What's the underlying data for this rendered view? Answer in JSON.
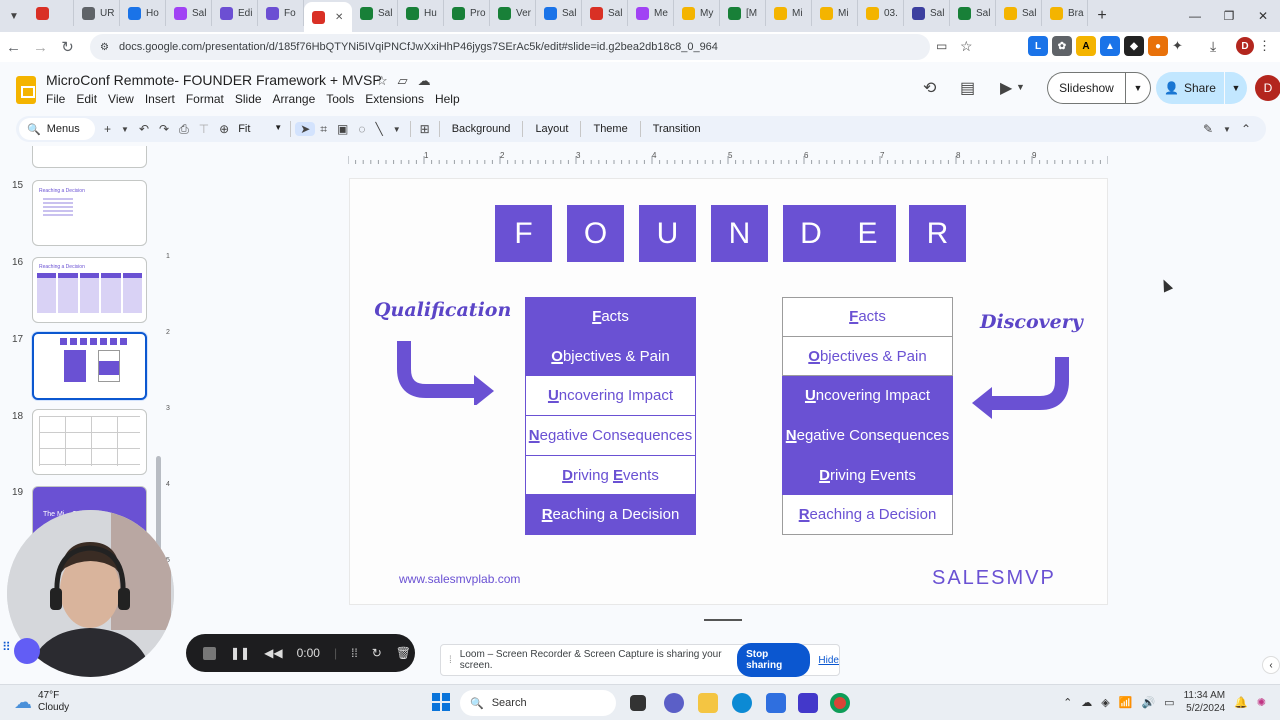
{
  "browser": {
    "tabs": [
      {
        "label": "",
        "color": "#d93025"
      },
      {
        "label": "UR",
        "color": "#5f6368"
      },
      {
        "label": "Ho",
        "color": "#1a73e8"
      },
      {
        "label": "Sal",
        "color": "#a142f4"
      },
      {
        "label": "Edi",
        "color": "#6c4fd3"
      },
      {
        "label": "Fo",
        "color": "#6c4fd3"
      },
      {
        "label": "",
        "color": "#d93025"
      },
      {
        "label": "Sal",
        "color": "#188038"
      },
      {
        "label": "Hu",
        "color": "#188038"
      },
      {
        "label": "Pro",
        "color": "#188038"
      },
      {
        "label": "Ver",
        "color": "#188038"
      },
      {
        "label": "Sal",
        "color": "#1a73e8"
      },
      {
        "label": "Sal",
        "color": "#d93025"
      },
      {
        "label": "Me",
        "color": "#a142f4"
      },
      {
        "label": "My",
        "color": "#f4b400"
      },
      {
        "label": "[M",
        "color": "#188038"
      },
      {
        "label": "Mi",
        "color": "#f4b400"
      },
      {
        "label": "Mi",
        "color": "#f4b400"
      },
      {
        "label": "03.",
        "color": "#f4b400"
      },
      {
        "label": "Sal",
        "color": "#3c3f9f"
      },
      {
        "label": "Sal",
        "color": "#188038"
      },
      {
        "label": "Sal",
        "color": "#f4b400"
      },
      {
        "label": "Bra",
        "color": "#f4b400"
      }
    ],
    "url": "docs.google.com/presentation/d/185f76HbQTYNi5IVqiPNCfJwXxiHhP46jygs7SErAc5k/edit#slide=id.g2bea2db18c8_0_964"
  },
  "app": {
    "title": "MicroConf Remmote- FOUNDER Framework + MVSP",
    "menu": [
      "File",
      "Edit",
      "View",
      "Insert",
      "Format",
      "Slide",
      "Arrange",
      "Tools",
      "Extensions",
      "Help"
    ],
    "slideshow_label": "Slideshow",
    "share_label": "Share",
    "user_initial": "D"
  },
  "toolbar": {
    "search_label": "Menus",
    "zoom": "Fit",
    "background_label": "Background",
    "layout_label": "Layout",
    "theme_label": "Theme",
    "transition_label": "Transition"
  },
  "filmstrip": {
    "slides": [
      {
        "number": "15",
        "title": "Reaching a Decision"
      },
      {
        "number": "16",
        "title": "Reaching a Decision"
      },
      {
        "number": "17",
        "title": "",
        "selected": true
      },
      {
        "number": "18",
        "title": ""
      },
      {
        "number": "19",
        "title": "The Mi... Sales"
      }
    ]
  },
  "ruler": {
    "inches": [
      "1",
      "2",
      "3",
      "4",
      "5",
      "6",
      "7",
      "8",
      "9"
    ],
    "vertical": [
      "1",
      "2",
      "3",
      "4",
      "5"
    ]
  },
  "slide": {
    "letters": [
      "F",
      "O",
      "U",
      "N",
      "D",
      "E",
      "R"
    ],
    "left_label": "Qualification",
    "right_label": "Discovery",
    "left_column": [
      {
        "initial": "F",
        "rest": "acts",
        "style": "filled"
      },
      {
        "initial": "O",
        "rest": "bjectives & Pain",
        "style": "filled"
      },
      {
        "initial": "U",
        "rest": "ncovering Impact",
        "style": "outline"
      },
      {
        "initial": "N",
        "rest": "egative Consequences",
        "style": "outline"
      },
      {
        "initial": "D",
        "rest": "riving ",
        "initial2": "E",
        "rest2": "vents",
        "style": "outline"
      },
      {
        "initial": "R",
        "rest": "eaching a Decision",
        "style": "filled"
      }
    ],
    "right_column": [
      {
        "initial": "F",
        "rest": "acts",
        "style": "outline"
      },
      {
        "initial": "O",
        "rest": "bjectives & Pain",
        "style": "outline"
      },
      {
        "initial": "U",
        "rest": "ncovering Impact",
        "style": "filled"
      },
      {
        "initial": "N",
        "rest": "egative Consequences",
        "style": "filled"
      },
      {
        "initial": "D",
        "rest": "riving Events",
        "style": "filled"
      },
      {
        "initial": "R",
        "rest": "eaching a Decision",
        "style": "outline"
      }
    ],
    "website": "www.salesmvplab.com",
    "brand": "SALESMVP",
    "accent_color": "#6a51d3"
  },
  "loom": {
    "timer": "0:00",
    "notice": "Loom – Screen Recorder & Screen Capture is sharing your screen.",
    "stop_label": "Stop sharing",
    "hide_label": "Hide"
  },
  "taskbar": {
    "temperature": "47°F",
    "weather": "Cloudy",
    "search_label": "Search",
    "time": "11:34 AM",
    "date": "5/2/2024"
  }
}
